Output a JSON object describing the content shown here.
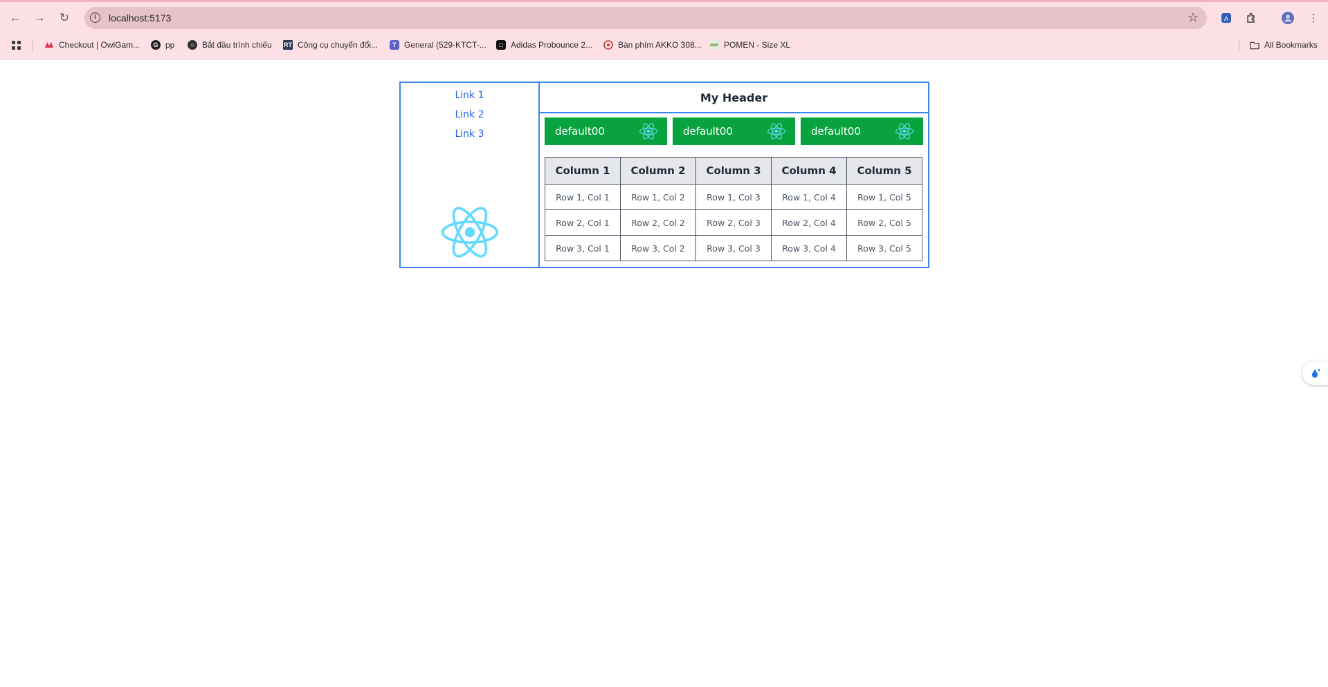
{
  "browser": {
    "url": "localhost:5173",
    "all_bookmarks_label": "All Bookmarks",
    "bookmarks": [
      {
        "label": "Checkout | OwlGam...",
        "icon": "owl-icon",
        "color": "#e0334f"
      },
      {
        "label": "pp",
        "icon": "g-icon",
        "color": "#222222"
      },
      {
        "label": "Bắt đầu trình chiếu",
        "icon": "globe-icon",
        "color": "#333333"
      },
      {
        "label": "Công cụ chuyển đổi...",
        "icon": "rt-icon",
        "color": "#2b3a55"
      },
      {
        "label": "General (529-KTCT-...",
        "icon": "teams-icon",
        "color": "#5b5fc7"
      },
      {
        "label": "Adidas Probounce 2...",
        "icon": "square-icon",
        "color": "#111111"
      },
      {
        "label": "Bàn phím AKKO 308...",
        "icon": "akko-icon",
        "color": "#c0392b"
      },
      {
        "label": "POMEN - Size XL",
        "icon": "shirt-icon",
        "color": "#9ab37a"
      }
    ]
  },
  "page": {
    "nav_links": [
      "Link 1",
      "Link 2",
      "Link 3"
    ],
    "header_title": "My Header",
    "cards": [
      {
        "label": "default00",
        "icon": "react-icon"
      },
      {
        "label": "default00",
        "icon": "react-icon"
      },
      {
        "label": "default00",
        "icon": "react-icon"
      }
    ],
    "table": {
      "columns": [
        "Column 1",
        "Column 2",
        "Column 3",
        "Column 4",
        "Column 5"
      ],
      "rows": [
        [
          "Row 1, Col 1",
          "Row 1, Col 2",
          "Row 1, Col 3",
          "Row 1, Col 4",
          "Row 1, Col 5"
        ],
        [
          "Row 2, Col 1",
          "Row 2, Col 2",
          "Row 2, Col 3",
          "Row 2, Col 4",
          "Row 2, Col 5"
        ],
        [
          "Row 3, Col 1",
          "Row 3, Col 2",
          "Row 3, Col 3",
          "Row 3, Col 4",
          "Row 3, Col 5"
        ]
      ]
    },
    "colors": {
      "border": "#3b82f6",
      "link": "#2563eb",
      "card_bg": "#08a33e",
      "react": "#61dafb"
    }
  }
}
